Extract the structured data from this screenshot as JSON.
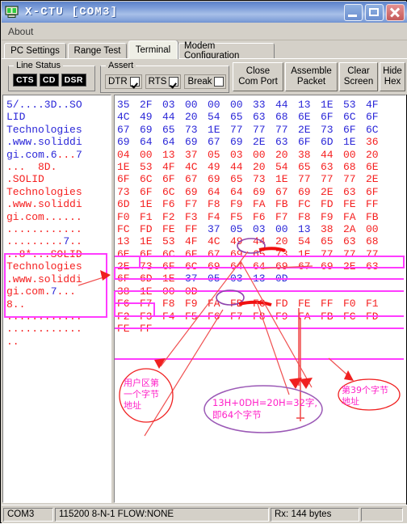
{
  "window": {
    "title": "X-CTU    [COM3]",
    "icon": "modem-icon",
    "buttons": {
      "minimize": "minimize-icon",
      "maximize": "maximize-icon",
      "close": "close-icon"
    }
  },
  "menubar": {
    "items": [
      "About"
    ]
  },
  "tabs": [
    {
      "label": "PC Settings",
      "active": false
    },
    {
      "label": "Range Test",
      "active": false
    },
    {
      "label": "Terminal",
      "active": true
    },
    {
      "label": "Modem Configuration",
      "active": false
    }
  ],
  "line_status": {
    "group_label": "Line Status",
    "leds": [
      "CTS",
      "CD",
      "DSR"
    ]
  },
  "assert": {
    "group_label": "Assert",
    "items": [
      {
        "label": "DTR",
        "checked": true
      },
      {
        "label": "RTS",
        "checked": true
      },
      {
        "label": "Break",
        "checked": false
      }
    ]
  },
  "toolbar_buttons": [
    {
      "line1": "Close",
      "line2": "Com Port"
    },
    {
      "line1": "Assemble",
      "line2": "Packet"
    },
    {
      "line1": "Clear",
      "line2": "Screen"
    },
    {
      "line1": "Hide",
      "line2": "Hex"
    }
  ],
  "ascii_pane": {
    "lines": [
      {
        "text": "5/....3D..SO",
        "color": "blue"
      },
      {
        "text": "LID",
        "color": "blue"
      },
      {
        "text": "Technologies",
        "color": "blue"
      },
      {
        "text": ".www.soliddi",
        "color": "blue"
      },
      {
        "text": "gi.com.6...7",
        "color": "mixed"
      },
      {
        "text": "...  8D.",
        "color": "red"
      },
      {
        "text": ".SOLID",
        "color": "red"
      },
      {
        "text": "Technologies",
        "color": "red"
      },
      {
        "text": ".www.soliddi",
        "color": "red"
      },
      {
        "text": "gi.com......",
        "color": "red"
      },
      {
        "text": "............",
        "color": "red"
      },
      {
        "text": ".........7..",
        "color": "mixed"
      },
      {
        "text": "..8*...SOLID",
        "color": "red"
      },
      {
        "text": "Technologies",
        "color": "red"
      },
      {
        "text": ".www.soliddi",
        "color": "red"
      },
      {
        "text": "gi.com.7...",
        "color": "mixed"
      },
      {
        "text": "8..",
        "color": "red"
      },
      {
        "text": "............",
        "color": "red"
      },
      {
        "text": "............",
        "color": "red"
      },
      {
        "text": "..",
        "color": "red"
      }
    ]
  },
  "hex_pane": {
    "bytes_per_row": 12,
    "rows": [
      {
        "bytes": [
          "35",
          "2F",
          "03",
          "00",
          "00",
          "00",
          "33",
          "44",
          "13",
          "1E",
          "53",
          "4F"
        ],
        "color": "blue"
      },
      {
        "bytes": [
          "4C",
          "49",
          "44",
          "20",
          "54",
          "65",
          "63",
          "68",
          "6E",
          "6F",
          "6C",
          "6F"
        ],
        "color": "blue"
      },
      {
        "bytes": [
          "67",
          "69",
          "65",
          "73",
          "1E",
          "77",
          "77",
          "77",
          "2E",
          "73",
          "6F",
          "6C"
        ],
        "color": "blue"
      },
      {
        "bytes": [
          "69",
          "64",
          "64",
          "69",
          "67",
          "69",
          "2E",
          "63",
          "6F",
          "6D",
          "1E",
          "36"
        ],
        "color": "blue",
        "last_red": true
      },
      {
        "bytes": [
          "04",
          "00",
          "13",
          "37",
          "05",
          "03",
          "00",
          "20",
          "38",
          "44",
          "00",
          "20"
        ],
        "color": "red"
      },
      {
        "bytes": [
          "1E",
          "53",
          "4F",
          "4C",
          "49",
          "44",
          "20",
          "54",
          "65",
          "63",
          "68",
          "6E"
        ],
        "color": "red"
      },
      {
        "bytes": [
          "6F",
          "6C",
          "6F",
          "67",
          "69",
          "65",
          "73",
          "1E",
          "77",
          "77",
          "77",
          "2E"
        ],
        "color": "red"
      },
      {
        "bytes": [
          "73",
          "6F",
          "6C",
          "69",
          "64",
          "64",
          "69",
          "67",
          "69",
          "2E",
          "63",
          "6F"
        ],
        "color": "red"
      },
      {
        "bytes": [
          "6D",
          "1E",
          "F6",
          "F7",
          "F8",
          "F9",
          "FA",
          "FB",
          "FC",
          "FD",
          "FE",
          "FF"
        ],
        "color": "red"
      },
      {
        "bytes": [
          "F0",
          "F1",
          "F2",
          "F3",
          "F4",
          "F5",
          "F6",
          "F7",
          "F8",
          "F9",
          "FA",
          "FB"
        ],
        "color": "red"
      },
      {
        "bytes": [
          "FC",
          "FD",
          "FE",
          "FF",
          "37",
          "05",
          "03",
          "00",
          "13",
          "38",
          "2A",
          "00"
        ],
        "color": "red",
        "blue_range": [
          4,
          8
        ]
      },
      {
        "bytes": [
          "13",
          "1E",
          "53",
          "4F",
          "4C",
          "49",
          "44",
          "20",
          "54",
          "65",
          "63",
          "68"
        ],
        "color": "red"
      },
      {
        "bytes": [
          "6E",
          "6F",
          "6C",
          "6F",
          "67",
          "69",
          "65",
          "73",
          "1E",
          "77",
          "77",
          "77"
        ],
        "color": "red"
      },
      {
        "bytes": [
          "2E",
          "73",
          "6F",
          "6C",
          "69",
          "64",
          "64",
          "69",
          "67",
          "69",
          "2E",
          "63"
        ],
        "color": "red"
      },
      {
        "bytes": [
          "6F",
          "6D",
          "1E",
          "37",
          "05",
          "03",
          "13",
          "0D"
        ],
        "color": "red",
        "blue_range": [
          3,
          7
        ]
      },
      {
        "bytes": [
          "38",
          "1E",
          "00",
          "0D"
        ],
        "color": "red"
      },
      {
        "bytes": [
          "F6",
          "F7",
          "F8",
          "F9",
          "FA",
          "FB",
          "FC",
          "FD",
          "FE",
          "FF",
          "F0",
          "F1"
        ],
        "color": "red"
      },
      {
        "bytes": [
          "F2",
          "F3",
          "F4",
          "F5",
          "F6",
          "F7",
          "F8",
          "F9",
          "FA",
          "FB",
          "FC",
          "FD"
        ],
        "color": "red"
      },
      {
        "bytes": [
          "FE",
          "FF"
        ],
        "color": "red"
      }
    ]
  },
  "annotations": {
    "callout_left": {
      "lines": [
        "用户区第",
        "一个字节",
        "地址"
      ],
      "shape": "circle",
      "color": "#ff2a2a"
    },
    "callout_center": {
      "lines": [
        "13H+0DH=20H=32字,",
        "即64个字节"
      ],
      "shape": "ellipse",
      "color": "#9b59b6"
    },
    "callout_right": {
      "lines": [
        "第39个字节",
        "地址"
      ],
      "shape": "ellipse",
      "color": "#ff2a2a"
    },
    "circled_bytes": [
      "00",
      "13"
    ],
    "highlight_color": "#ff3cff"
  },
  "statusbar": {
    "port": "COM3",
    "settings": "115200 8-N-1  FLOW:NONE",
    "rx": "Rx: 144 bytes",
    "spare": ""
  }
}
